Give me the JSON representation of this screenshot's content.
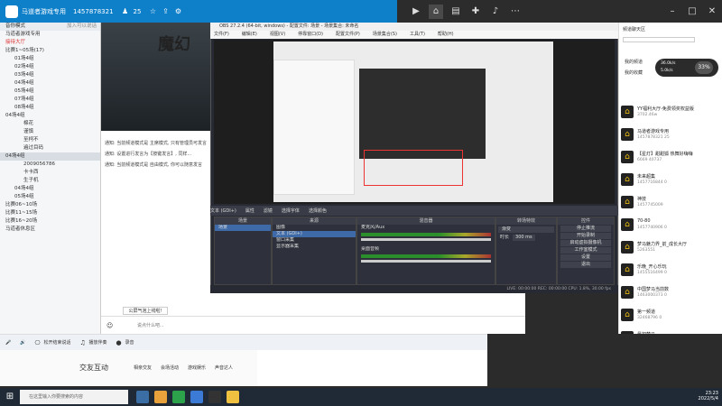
{
  "topbar": {
    "title": "马道者游戏专用",
    "room_id": "1457878321",
    "online": "25"
  },
  "nav": {
    "icons": [
      "video-icon",
      "home-icon",
      "chart-icon",
      "gamepad-icon",
      "music-icon",
      "more-icon"
    ]
  },
  "lefttree": {
    "header_left": "音你模式",
    "header_right": "加入可以说话",
    "rows": [
      {
        "t": "马道者游戏专用",
        "cls": ""
      },
      {
        "t": "接待大厅",
        "cls": "red"
      },
      {
        "t": "比赛1~05场(17)",
        "cls": ""
      },
      {
        "t": "01场4组",
        "cls": "l1"
      },
      {
        "t": "02场4组",
        "cls": "l1"
      },
      {
        "t": "03场4组",
        "cls": "l1"
      },
      {
        "t": "04场4组",
        "cls": "l1"
      },
      {
        "t": "05场4组",
        "cls": "l1"
      },
      {
        "t": "07场4组",
        "cls": "l1"
      },
      {
        "t": "08场4组",
        "cls": "l1"
      },
      {
        "t": "04场4组",
        "cls": ""
      },
      {
        "t": "棉花",
        "cls": "l2"
      },
      {
        "t": "谨慎",
        "cls": "l2"
      },
      {
        "t": "至柯不",
        "cls": "l2"
      },
      {
        "t": "遍过目码",
        "cls": "l2"
      },
      {
        "t": "04场4组",
        "cls": "sel"
      },
      {
        "t": "2009056786",
        "cls": "l2"
      },
      {
        "t": "卡卡西",
        "cls": "l2"
      },
      {
        "t": "生子机",
        "cls": "l2"
      },
      {
        "t": "04场4组",
        "cls": "l1"
      },
      {
        "t": "05场4组",
        "cls": "l1"
      },
      {
        "t": "比赛06~10场",
        "cls": ""
      },
      {
        "t": "比赛11~15场",
        "cls": ""
      },
      {
        "t": "比赛16~20场",
        "cls": ""
      },
      {
        "t": "马道者休息区",
        "cls": ""
      }
    ]
  },
  "room": {
    "banner_title": "魔幻",
    "messages": [
      "通知: 当前频道模式是 主席模式, 只有管理员可发言",
      "通知: 设置进行发言为【按键发言】, 同样...",
      "通知: 当前频道模式是 自由模式, 你可以随意发言"
    ],
    "input_placeholder": "说点什么吧...",
    "popup_label": "公屏气泡上线啦!"
  },
  "toolbar2": {
    "items": [
      "松开结束说话",
      "播放伴奏",
      "录音"
    ]
  },
  "interact": {
    "title": "交友互动",
    "tabs": [
      "相亲交友",
      "会场活动",
      "游戏娱乐",
      "声音达人"
    ]
  },
  "obs": {
    "title": "OBS 27.2.4 (64-bit, windows) - 配置文件: 场景 - 场景集合: 未命名",
    "menu": [
      "文件(F)",
      "编辑(E)",
      "视图(V)",
      "停靠窗口(D)",
      "配置文件(P)",
      "场景集合(S)",
      "工具(T)",
      "帮助(H)"
    ],
    "labelbar": [
      "文本 (GDI+)",
      "属性",
      "滤镜",
      "选择字体",
      "选择颜色"
    ],
    "docks": {
      "scenes": {
        "title": "场景",
        "items": [
          "场景"
        ]
      },
      "sources": {
        "title": "来源",
        "items": [
          "图像",
          "文本 (GDI+)",
          "窗口采集",
          "显示器采集"
        ]
      },
      "mixer": {
        "title": "混音器",
        "tracks": [
          "麦克风/Aux",
          "桌面音频"
        ]
      },
      "transitions": {
        "title": "转场特效",
        "type": "渐变",
        "duration_label": "时长",
        "duration": "300 ms"
      },
      "controls": {
        "title": "控件",
        "buttons": [
          "停止推流",
          "开始录制",
          "启动虚拟摄像机",
          "工作室模式",
          "设置",
          "退出"
        ]
      }
    },
    "status": "LIVE: 00:00:00    REC: 00:00:00    CPU: 1.8%, 30.00 fps"
  },
  "rightpanel": {
    "header": "频道聊天区",
    "tabs": [
      "我的频道",
      "我的收藏"
    ],
    "stats": {
      "upload": "36.0k/s",
      "download": "5.0k/s",
      "percent": "33%"
    },
    "items": [
      {
        "nm": "YY福利大厅-免费领奖权益版",
        "sub": "3702.46w"
      },
      {
        "nm": "马道者游戏专用",
        "sub": "1457878321  25"
      },
      {
        "nm": "【星灯】甜甜狐 热舞好嗨嗨",
        "sub": "6669  40737"
      },
      {
        "nm": "未来超集",
        "sub": "1457716844  0"
      },
      {
        "nm": "神技",
        "sub": "1457745009"
      },
      {
        "nm": "70-80",
        "sub": "1457740906  0"
      },
      {
        "nm": "梦马魅力界_前_成长大厅",
        "sub": "5263551"
      },
      {
        "nm": "乐晚_开心乐玩",
        "sub": "1455516499  0"
      },
      {
        "nm": "中国梦马当前数",
        "sub": "1463000373  0"
      },
      {
        "nm": "第一频道",
        "sub": "32468796  0"
      },
      {
        "nm": "最初梦马",
        "sub": ""
      }
    ]
  },
  "taskbar": {
    "search": "在这里输入你要搜索的内容",
    "time": "23:23",
    "date": "2022/5/4"
  },
  "colors": {
    "accent": "#0e7fc9",
    "obs_bg": "#272a33",
    "live_red": "#d33"
  }
}
